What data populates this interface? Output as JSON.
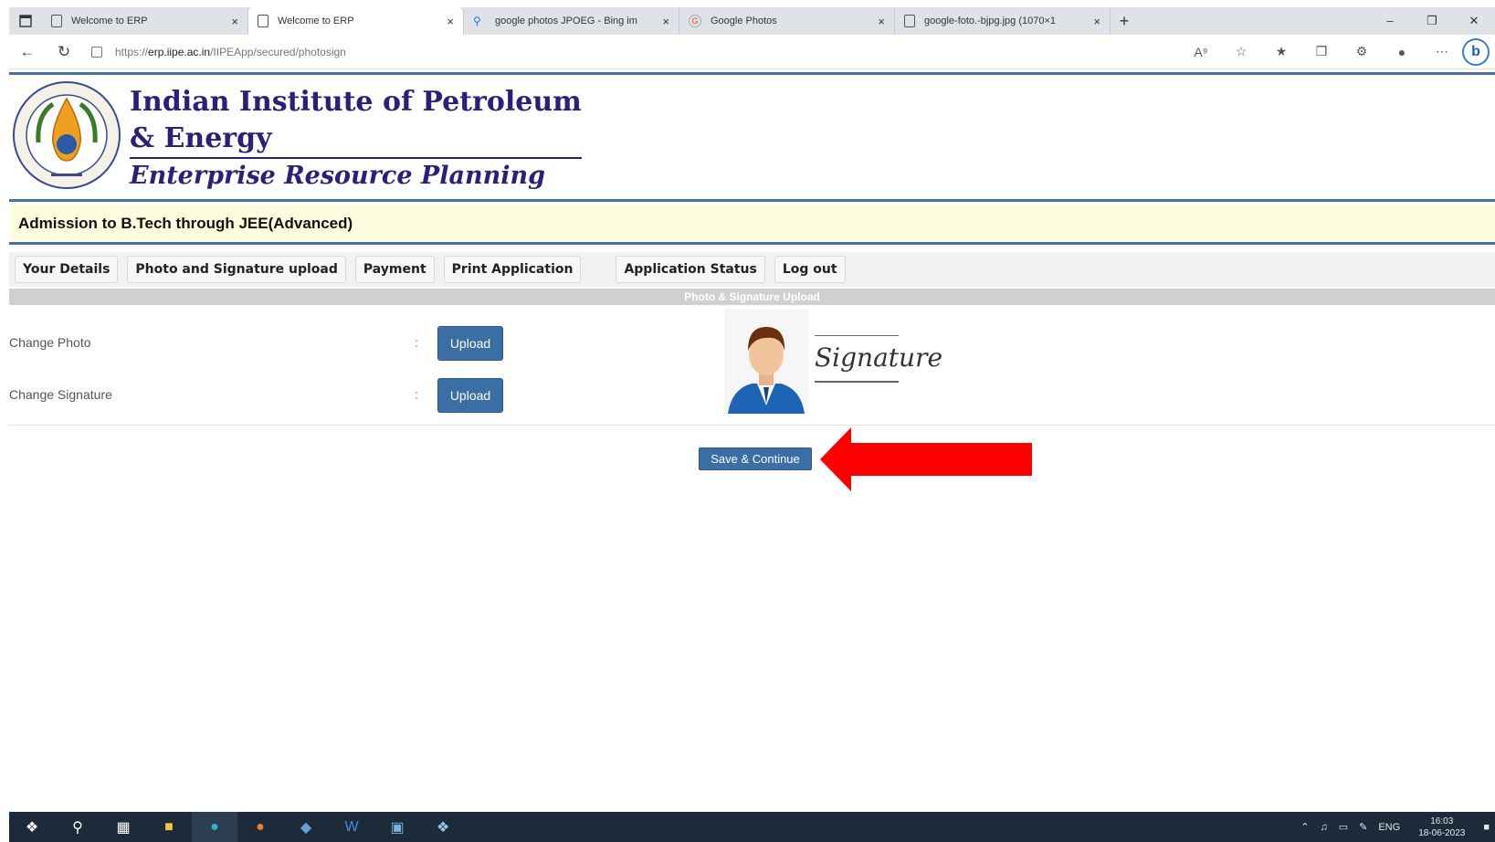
{
  "browser": {
    "tabs": [
      {
        "title": "Welcome to ERP",
        "active": false,
        "icon": "page-icon"
      },
      {
        "title": "Welcome to ERP",
        "active": true,
        "icon": "page-icon"
      },
      {
        "title": "google photos JPOEG - Bing im",
        "active": false,
        "icon": "search-icon"
      },
      {
        "title": "Google Photos",
        "active": false,
        "icon": "google-icon"
      },
      {
        "title": "google-foto.-bjpg.jpg (1070×1",
        "active": false,
        "icon": "page-icon"
      }
    ],
    "url_prefix": "https://",
    "url_host": "erp.iipe.ac.in",
    "url_path": "/IIPEApp/secured/photosign",
    "new_tab": "+",
    "close_glyph": "×"
  },
  "header": {
    "title_line1": "Indian Institute of Petroleum",
    "title_line2": "& Energy",
    "subtitle": "Enterprise Resource Planning"
  },
  "admission_bar": "Admission to B.Tech through JEE(Advanced)",
  "menu": {
    "your_details": "Your Details",
    "photo_signature": "Photo and Signature upload",
    "payment": "Payment",
    "print_application": "Print Application",
    "application_status": "Application Status",
    "logout": "Log out"
  },
  "section_title": "Photo & Signature Upload",
  "form": {
    "change_photo_label": "Change Photo",
    "change_signature_label": "Change Signature",
    "colon": ":",
    "upload_label": "Upload",
    "signature_preview_text": "Signature"
  },
  "save_button": "Save & Continue",
  "colors": {
    "accent_blue": "#3a6ea5",
    "header_navy": "#2b1f7a",
    "admission_bg": "#fffde0",
    "arrow_red": "#ff0000"
  },
  "taskbar": {
    "language": "ENG",
    "time": "16:03",
    "date": "18-06-2023"
  }
}
